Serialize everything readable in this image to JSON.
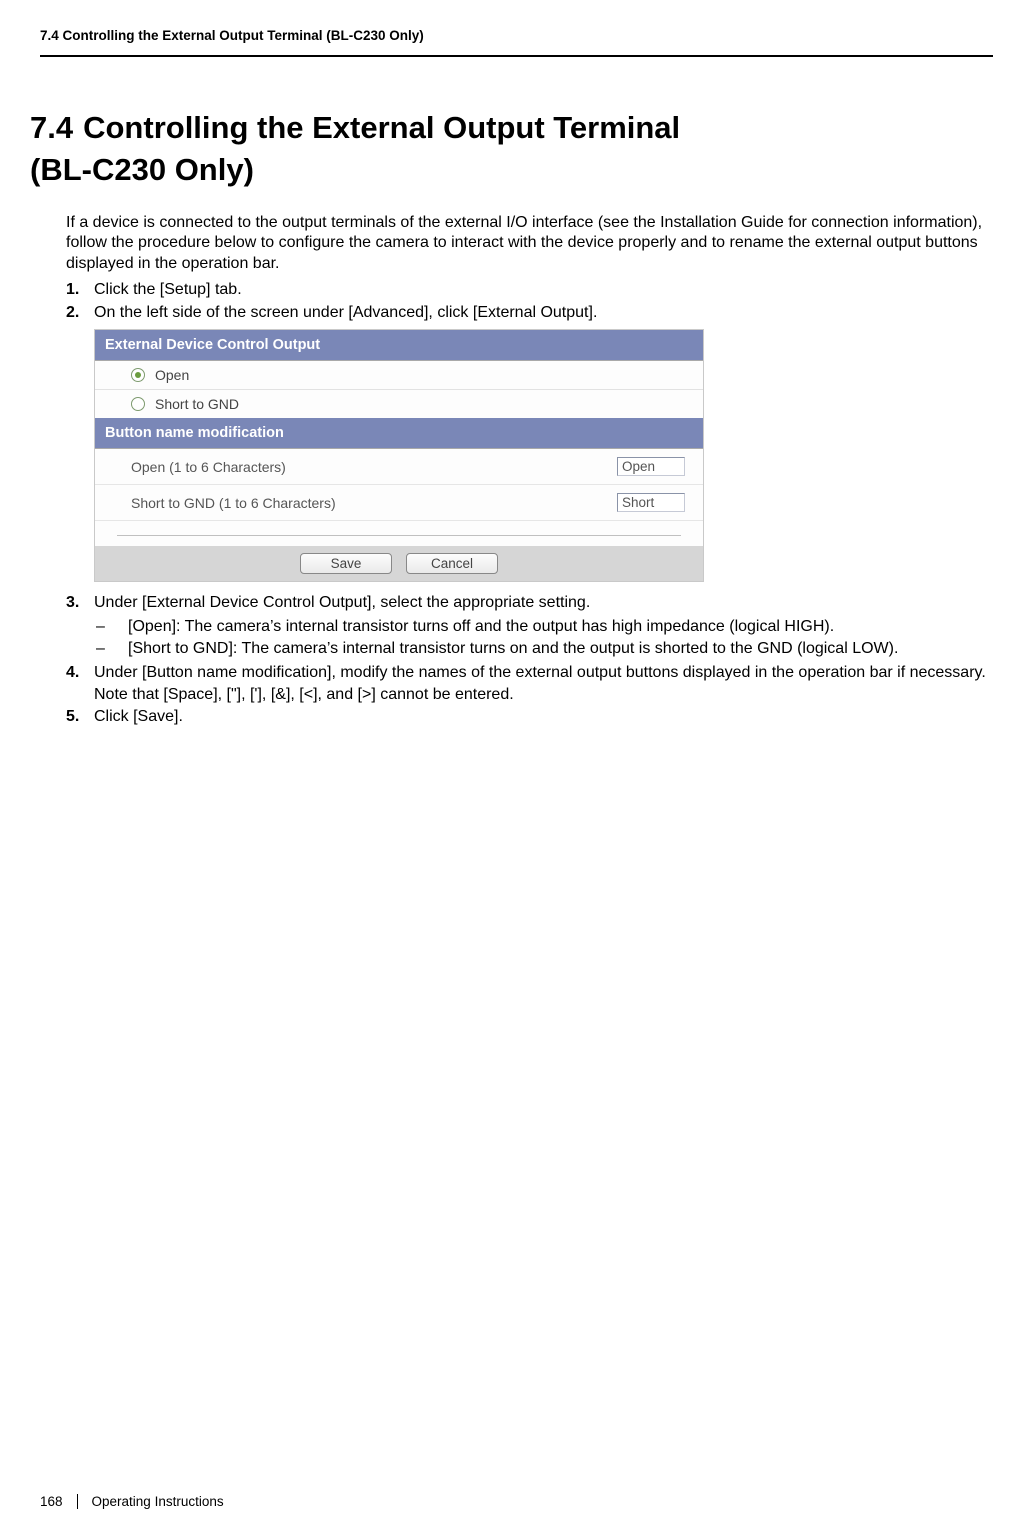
{
  "header": {
    "running": "7.4 Controlling the External Output Terminal (BL-C230 Only)"
  },
  "title": {
    "num": "7.4",
    "line1": "Controlling the External Output Terminal",
    "line2": "(BL-C230 Only)"
  },
  "intro": "If a device is connected to the output terminals of the external I/O interface (see the Installation Guide for connection information), follow the procedure below to configure the camera to interact with the device properly and to rename the external output buttons displayed in the operation bar.",
  "steps": {
    "s1": {
      "num": "1.",
      "text": "Click the [Setup] tab."
    },
    "s2": {
      "num": "2.",
      "text": "On the left side of the screen under [Advanced], click [External Output]."
    },
    "s3": {
      "num": "3.",
      "text": "Under [External Device Control Output], select the appropriate setting.",
      "sub": {
        "a": "[Open]: The camera’s internal transistor turns off and the output has high impedance (logical HIGH).",
        "b": "[Short to GND]: The camera’s internal transistor turns on and the output is shorted to the GND (logical LOW)."
      }
    },
    "s4": {
      "num": "4.",
      "text": "Under [Button name modification], modify the names of the external output buttons displayed in the operation bar if necessary. Note that [Space], [\"], ['], [&], [<], and [>] cannot be entered."
    },
    "s5": {
      "num": "5.",
      "text": "Click [Save]."
    }
  },
  "panel": {
    "h1": "External Device Control Output",
    "opt1": "Open",
    "opt2": "Short to GND",
    "h2": "Button name modification",
    "row1_label": "Open (1 to 6 Characters)",
    "row1_value": "Open",
    "row2_label": "Short to GND (1 to 6 Characters)",
    "row2_value": "Short",
    "btn_save": "Save",
    "btn_cancel": "Cancel"
  },
  "footer": {
    "page": "168",
    "doc": "Operating Instructions"
  }
}
